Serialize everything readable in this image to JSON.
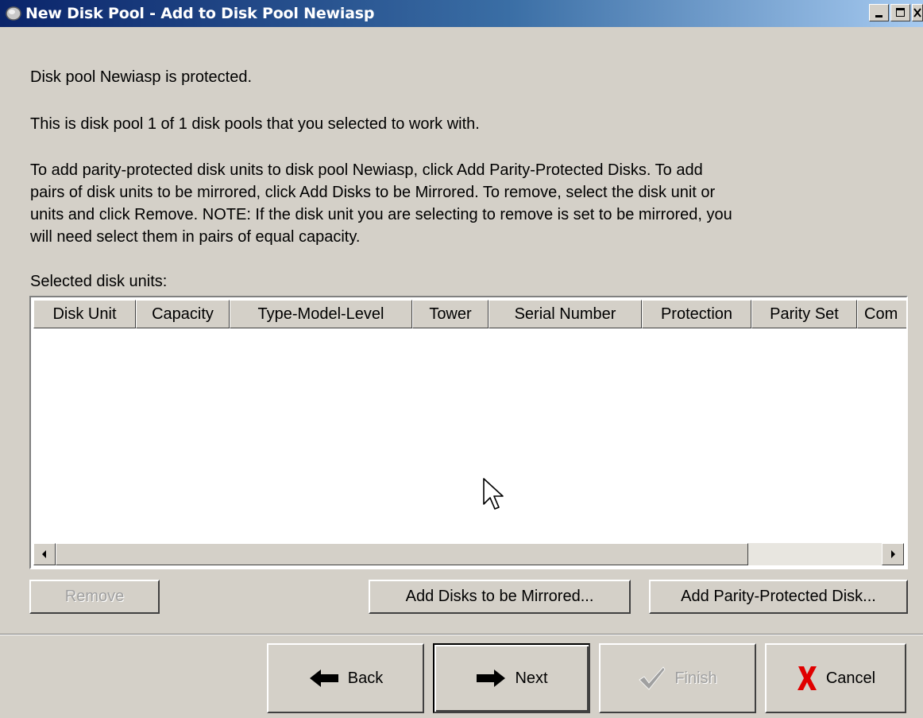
{
  "window": {
    "title": "New Disk Pool - Add to Disk Pool Newiasp",
    "icon": "disk-pool-icon"
  },
  "text": {
    "protected": "Disk pool Newiasp is protected.",
    "selection": "This is disk pool 1 of 1 disk pools that you selected to work with.",
    "instructions_lines": [
      "To add parity-protected disk units to disk pool Newiasp, click Add Parity-Protected Disks. To add",
      "pairs of disk units to be mirrored, click Add Disks to be Mirrored. To remove, select the disk unit or",
      "units and click Remove. NOTE: If the disk unit you are selecting to remove is set to be mirrored, you",
      "will need select them in pairs of equal capacity."
    ]
  },
  "table": {
    "label": "Selected disk units:",
    "columns": [
      "Disk Unit",
      "Capacity",
      "Type-Model-Level",
      "Tower",
      "Serial Number",
      "Protection",
      "Parity Set",
      "Com"
    ],
    "rows": []
  },
  "actions": {
    "remove": "Remove",
    "add_mirrored": "Add Disks to be Mirrored...",
    "add_parity": "Add Parity-Protected Disk..."
  },
  "nav": {
    "back": "Back",
    "next": "Next",
    "finish": "Finish",
    "cancel": "Cancel"
  },
  "colors": {
    "title_start": "#0a246a",
    "title_end": "#a6caf0",
    "window_bg": "#d4d0c8",
    "cancel_x": "#e00000"
  }
}
